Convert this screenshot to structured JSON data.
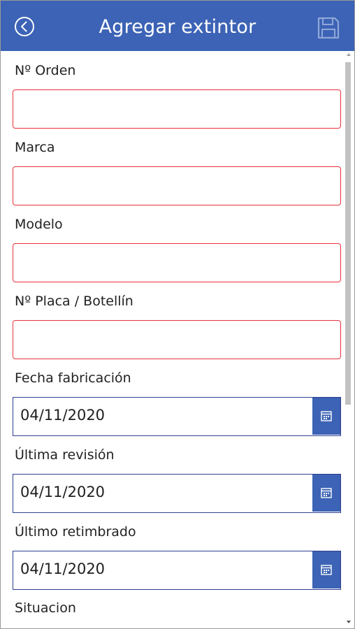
{
  "header": {
    "title": "Agregar extintor",
    "back_icon": "back-circle-icon",
    "save_icon": "save-disk-icon"
  },
  "colors": {
    "header_bg": "#3c63b5",
    "required_border": "#e8323c",
    "date_border": "#2f3f8f",
    "calendar_button_bg": "#3c63b5"
  },
  "form": {
    "orden_label": "Nº Orden",
    "orden_value": "",
    "marca_label": "Marca",
    "marca_value": "",
    "modelo_label": "Modelo",
    "modelo_value": "",
    "placa_label": "Nº Placa / Botellín",
    "placa_value": "",
    "fecha_fabricacion_label": "Fecha fabricación",
    "fecha_fabricacion_value": "04/11/2020",
    "ultima_revision_label": "Última revisión",
    "ultima_revision_value": "04/11/2020",
    "ultimo_retimbrado_label": "Último retimbrado",
    "ultimo_retimbrado_value": "04/11/2020",
    "situacion_label": "Situacion"
  }
}
